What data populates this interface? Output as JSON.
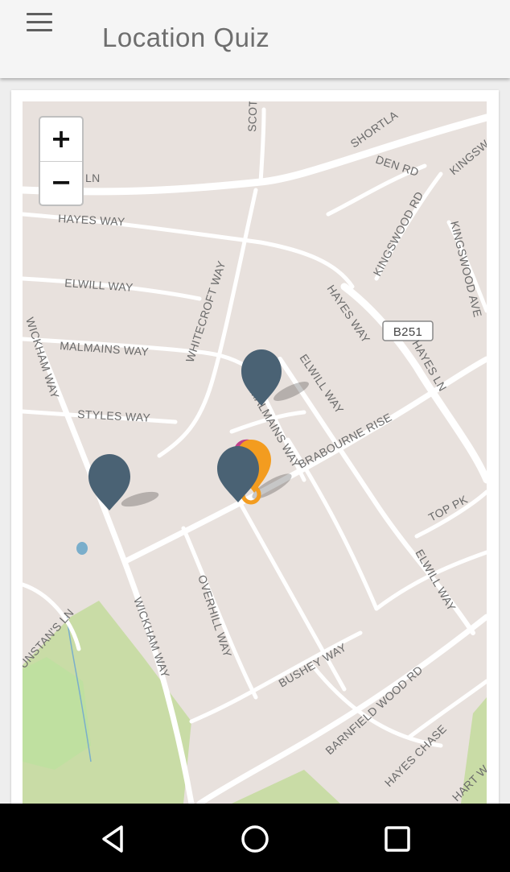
{
  "app": {
    "title": "Location Quiz"
  },
  "zoom": {
    "in_label": "+",
    "out_label": "−"
  },
  "map": {
    "streets": [
      "HAYES WAY",
      "ELWILL WAY",
      "MALMAINS WAY",
      "STYLES WAY",
      "WICKHAM WAY",
      "WHITECROFT WAY",
      "HAYES WAY",
      "ELWILL WAY",
      "MALMAINS WAY",
      "BRABOURNE RISE",
      "HAYES LN",
      "KINGSWOOD RD",
      "KINGSWOOD AVE",
      "SHORTLA",
      "DEN RD",
      "KINGSWO",
      "SCOT",
      "OVERHILL WAY",
      "WICKHAM WAY",
      "UNSTAN'S LN",
      "BUSHEY WAY",
      "BARNFIELD WOOD RD",
      "ELWILL WAY",
      "TOP PK",
      "HAYES CHASE",
      "HART W",
      "LN"
    ],
    "road_badge": "B251",
    "marker_colors": {
      "pin": "#4a6274",
      "answer": "#f39c1f",
      "accent": "#c0408a",
      "water": "#7aaecb",
      "park": "#c9dca6"
    }
  },
  "nav": {
    "back": "back-icon",
    "home": "home-icon",
    "recent": "recent-apps-icon"
  }
}
